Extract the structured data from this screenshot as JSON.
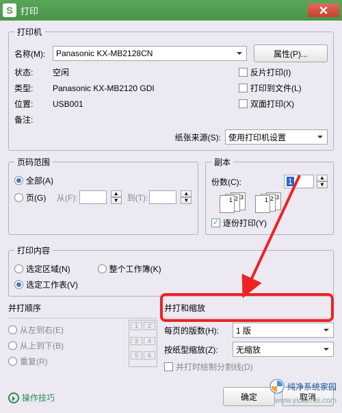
{
  "window": {
    "title": "打印"
  },
  "printer": {
    "legend": "打印机",
    "name_label": "名称(M):",
    "name_value": "Panasonic KX-MB2128CN",
    "props_button": "属性(P)...",
    "status_label": "状态:",
    "status_value": "空闲",
    "type_label": "类型:",
    "type_value": "Panasonic KX-MB2120 GDI",
    "where_label": "位置:",
    "where_value": "USB001",
    "comment_label": "备注:",
    "reverse_label": "反片打印(I)",
    "tofile_label": "打印到文件(L)",
    "duplex_label": "双面打印(X)",
    "papersource_label": "纸张来源(S):",
    "papersource_value": "使用打印机设置"
  },
  "range": {
    "legend": "页码范围",
    "all_label": "全部(A)",
    "pages_label": "页(G)",
    "from_label": "从(F):",
    "to_label": "到(T):"
  },
  "copies": {
    "legend": "副本",
    "count_label": "份数(C):",
    "count_value": "1",
    "collate_label": "逐份打印(Y)"
  },
  "content": {
    "legend": "打印内容",
    "selection_label": "选定区域(N)",
    "workbook_label": "整个工作簿(K)",
    "sheet_label": "选定工作表(V)"
  },
  "order": {
    "heading": "并打顺序",
    "lr_label": "从左到右(E)",
    "tb_label": "从上到下(B)",
    "repeat_label": "重复(R)"
  },
  "scale": {
    "heading": "并打和缩放",
    "perpage_label": "每页的版数(H):",
    "perpage_value": "1 版",
    "zoom_label": "按纸型缩放(Z):",
    "zoom_value": "无缩放",
    "drawlines_label": "并打时绘制分割线(D)"
  },
  "footer": {
    "tip": "操作技巧",
    "ok": "确定",
    "cancel": "取消"
  },
  "watermark": {
    "brand": "纯净系统家园",
    "url": "www.yidaimei.com"
  }
}
